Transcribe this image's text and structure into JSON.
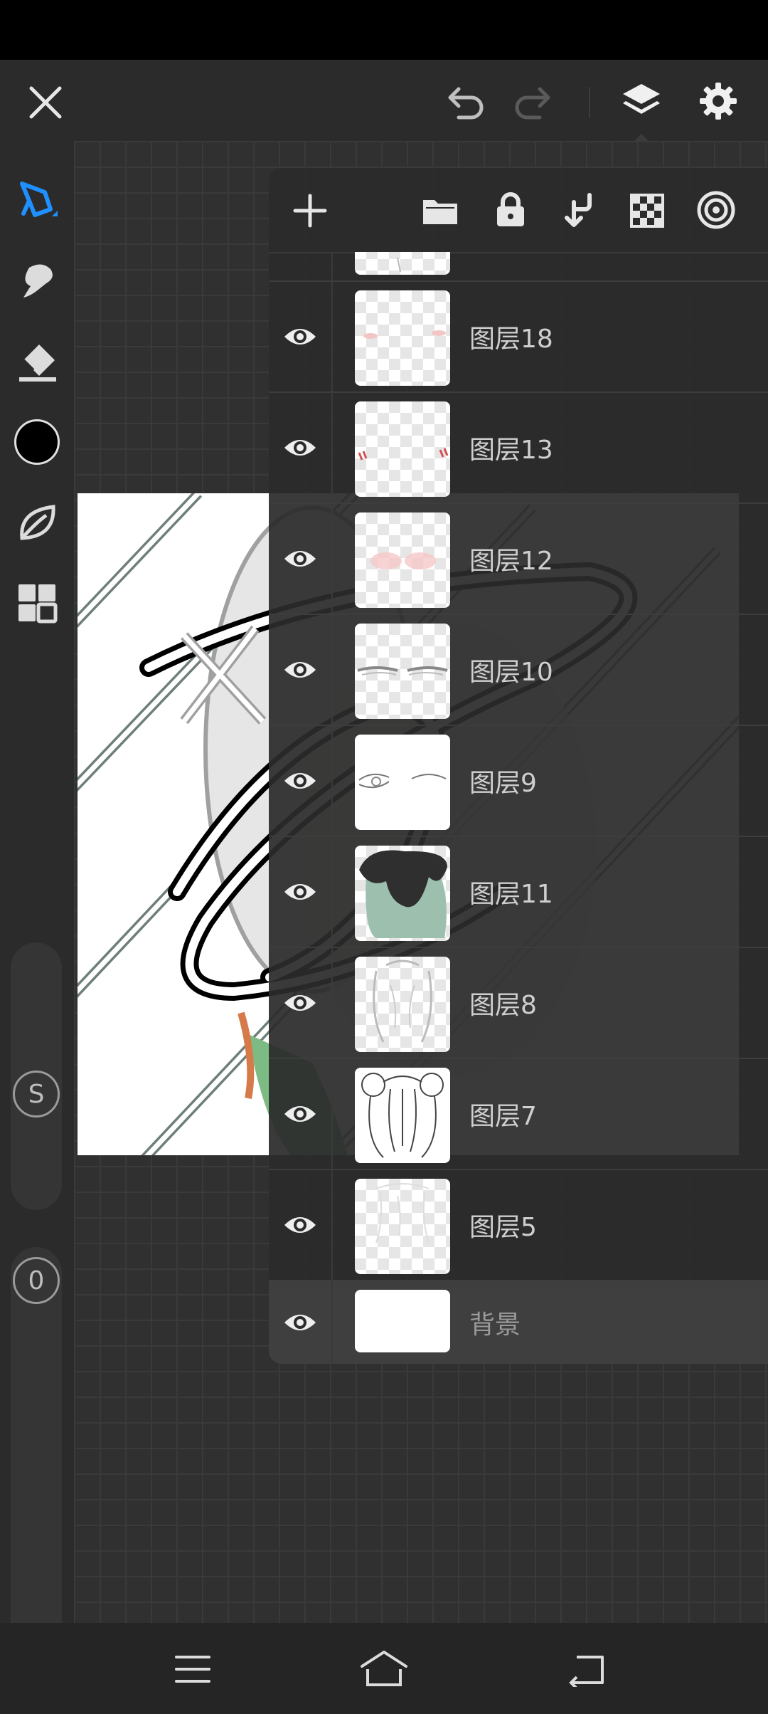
{
  "layers": [
    {
      "name": "图层18",
      "visible": true
    },
    {
      "name": "图层13",
      "visible": true
    },
    {
      "name": "图层12",
      "visible": true
    },
    {
      "name": "图层10",
      "visible": true
    },
    {
      "name": "图层9",
      "visible": true
    },
    {
      "name": "图层11",
      "visible": true
    },
    {
      "name": "图层8",
      "visible": true
    },
    {
      "name": "图层7",
      "visible": true
    },
    {
      "name": "图层5",
      "visible": true
    },
    {
      "name": "背景",
      "visible": true
    }
  ],
  "sliders": {
    "size_value": "S",
    "opacity_value": "0"
  },
  "colors": {
    "accent": "#1e90ff",
    "current_color": "#000000",
    "panel_bg": "#2b2b2b"
  },
  "icons": {
    "top_left": "close-icon",
    "top_right": [
      "undo-icon",
      "redo-icon",
      "layers-icon",
      "settings-icon"
    ],
    "panel_toolbar": [
      "add-layer-icon",
      "folder-icon",
      "lock-icon",
      "merge-down-icon",
      "transparency-icon",
      "blend-icon"
    ],
    "left_tools": [
      "pen-icon",
      "smudge-icon",
      "eraser-icon",
      "color-swatch",
      "leaf-icon",
      "materials-icon"
    ],
    "navbar": [
      "menu-icon",
      "home-icon",
      "back-icon"
    ]
  }
}
